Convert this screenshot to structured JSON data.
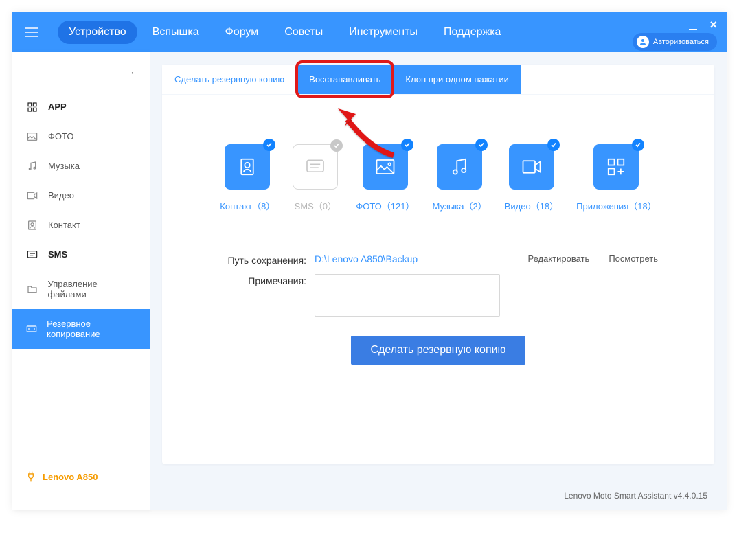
{
  "nav": {
    "items": [
      "Устройство",
      "Вспышка",
      "Форум",
      "Советы",
      "Инструменты",
      "Поддержка"
    ],
    "login": "Авторизоваться"
  },
  "sidebar": {
    "items": [
      {
        "label": "APP",
        "icon": "grid"
      },
      {
        "label": "ФОТО",
        "icon": "photo"
      },
      {
        "label": "Музыка",
        "icon": "music"
      },
      {
        "label": "Видео",
        "icon": "video"
      },
      {
        "label": "Контакт",
        "icon": "contact"
      },
      {
        "label": "SMS",
        "icon": "sms"
      },
      {
        "label": "Управление файлами",
        "icon": "files"
      },
      {
        "label": "Резервное копирование",
        "icon": "backup"
      }
    ],
    "device": "Lenovo A850"
  },
  "subtabs": [
    "Сделать резервную копию",
    "Восстанавливать",
    "Клон при одном нажатии"
  ],
  "cards": [
    {
      "label": "Контакт",
      "count": "（8）",
      "checked": true,
      "icon": "contact"
    },
    {
      "label": "SMS",
      "count": "（0）",
      "checked": false,
      "icon": "sms"
    },
    {
      "label": "ФОТО",
      "count": "（121）",
      "checked": true,
      "icon": "photo"
    },
    {
      "label": "Музыка",
      "count": "（2）",
      "checked": true,
      "icon": "music"
    },
    {
      "label": "Видео",
      "count": "（18）",
      "checked": true,
      "icon": "video"
    },
    {
      "label": "Приложения",
      "count": "（18）",
      "checked": true,
      "icon": "apps"
    }
  ],
  "form": {
    "path_label": "Путь сохранения:",
    "path_value": "D:\\Lenovo A850\\Backup",
    "notes_label": "Примечания:",
    "edit": "Редактировать",
    "view": "Посмотреть"
  },
  "big_button": "Сделать резервную копию",
  "footer": "Lenovo Moto Smart Assistant v4.4.0.15"
}
